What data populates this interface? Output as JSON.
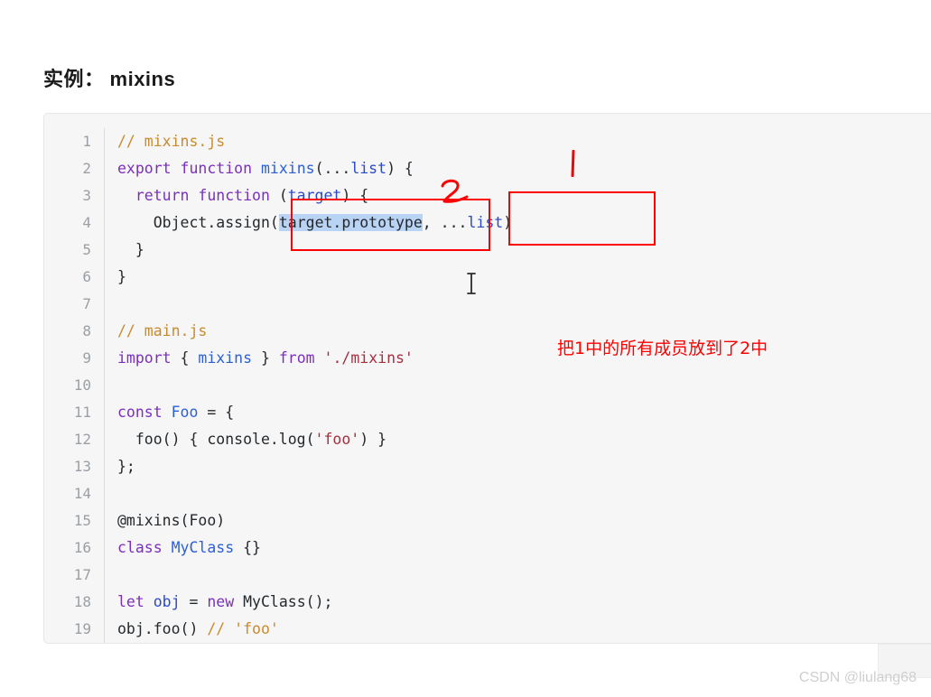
{
  "heading": {
    "cn": "实例：",
    "en": "mixins"
  },
  "code": {
    "language": "javascript",
    "lines": [
      {
        "num": "1",
        "tokens": [
          {
            "t": "// mixins.js",
            "c": "t-com"
          }
        ]
      },
      {
        "num": "2",
        "tokens": [
          {
            "t": "export function ",
            "c": "t-kw"
          },
          {
            "t": "mixins",
            "c": "t-fn"
          },
          {
            "t": "(...",
            "c": "t-pln"
          },
          {
            "t": "list",
            "c": "t-var"
          },
          {
            "t": ") {",
            "c": "t-pln"
          }
        ]
      },
      {
        "num": "3",
        "tokens": [
          {
            "t": "  return function ",
            "c": "t-kw"
          },
          {
            "t": "(",
            "c": "t-pln"
          },
          {
            "t": "target",
            "c": "t-var"
          },
          {
            "t": ") {",
            "c": "t-pln"
          }
        ]
      },
      {
        "num": "4",
        "tokens": [
          {
            "t": "    Object.assign",
            "c": "t-pln"
          },
          {
            "t": "(",
            "c": "t-pln"
          },
          {
            "t": "target.prototype",
            "c": "t-sel"
          },
          {
            "t": ", ...",
            "c": "t-pln"
          },
          {
            "t": "list",
            "c": "t-var"
          },
          {
            "t": ")",
            "c": "t-pln"
          }
        ]
      },
      {
        "num": "5",
        "tokens": [
          {
            "t": "  }",
            "c": "t-pln"
          }
        ]
      },
      {
        "num": "6",
        "tokens": [
          {
            "t": "}",
            "c": "t-pln"
          }
        ]
      },
      {
        "num": "7",
        "tokens": [
          {
            "t": "",
            "c": "t-pln"
          }
        ]
      },
      {
        "num": "8",
        "tokens": [
          {
            "t": "// main.js",
            "c": "t-com"
          }
        ]
      },
      {
        "num": "9",
        "tokens": [
          {
            "t": "import",
            "c": "t-kw"
          },
          {
            "t": " { ",
            "c": "t-pln"
          },
          {
            "t": "mixins",
            "c": "t-fn"
          },
          {
            "t": " } ",
            "c": "t-pln"
          },
          {
            "t": "from",
            "c": "t-kw"
          },
          {
            "t": " ",
            "c": "t-pln"
          },
          {
            "t": "'./mixins'",
            "c": "t-str"
          }
        ]
      },
      {
        "num": "10",
        "tokens": [
          {
            "t": "",
            "c": "t-pln"
          }
        ]
      },
      {
        "num": "11",
        "tokens": [
          {
            "t": "const",
            "c": "t-kw"
          },
          {
            "t": " ",
            "c": "t-pln"
          },
          {
            "t": "Foo",
            "c": "t-fn"
          },
          {
            "t": " = {",
            "c": "t-pln"
          }
        ]
      },
      {
        "num": "12",
        "tokens": [
          {
            "t": "  foo() { console.log(",
            "c": "t-pln"
          },
          {
            "t": "'foo'",
            "c": "t-str"
          },
          {
            "t": ") }",
            "c": "t-pln"
          }
        ]
      },
      {
        "num": "13",
        "tokens": [
          {
            "t": "};",
            "c": "t-pln"
          }
        ]
      },
      {
        "num": "14",
        "tokens": [
          {
            "t": "",
            "c": "t-pln"
          }
        ]
      },
      {
        "num": "15",
        "tokens": [
          {
            "t": "@mixins(Foo)",
            "c": "t-pln"
          }
        ]
      },
      {
        "num": "16",
        "tokens": [
          {
            "t": "class",
            "c": "t-kw"
          },
          {
            "t": " ",
            "c": "t-pln"
          },
          {
            "t": "MyClass",
            "c": "t-fn"
          },
          {
            "t": " {}",
            "c": "t-pln"
          }
        ]
      },
      {
        "num": "17",
        "tokens": [
          {
            "t": "",
            "c": "t-pln"
          }
        ]
      },
      {
        "num": "18",
        "tokens": [
          {
            "t": "let",
            "c": "t-kw"
          },
          {
            "t": " ",
            "c": "t-pln"
          },
          {
            "t": "obj",
            "c": "t-var"
          },
          {
            "t": " = ",
            "c": "t-pln"
          },
          {
            "t": "new",
            "c": "t-kw"
          },
          {
            "t": " MyClass();",
            "c": "t-pln"
          }
        ]
      },
      {
        "num": "19",
        "tokens": [
          {
            "t": "obj.foo() ",
            "c": "t-pln"
          },
          {
            "t": "// 'foo'",
            "c": "t-com"
          }
        ]
      }
    ]
  },
  "annotations": {
    "color": "#ff0000",
    "marker_1_label": "1",
    "marker_2_label": "2",
    "note": "把1中的所有成员放到了2中",
    "box_1_target": "...list)",
    "box_2_target": "(target.prototype"
  },
  "selection": {
    "text": "target.prototype",
    "highlight_color": "#b9d3f5"
  },
  "watermark": {
    "text": "CSDN @liulang68"
  }
}
